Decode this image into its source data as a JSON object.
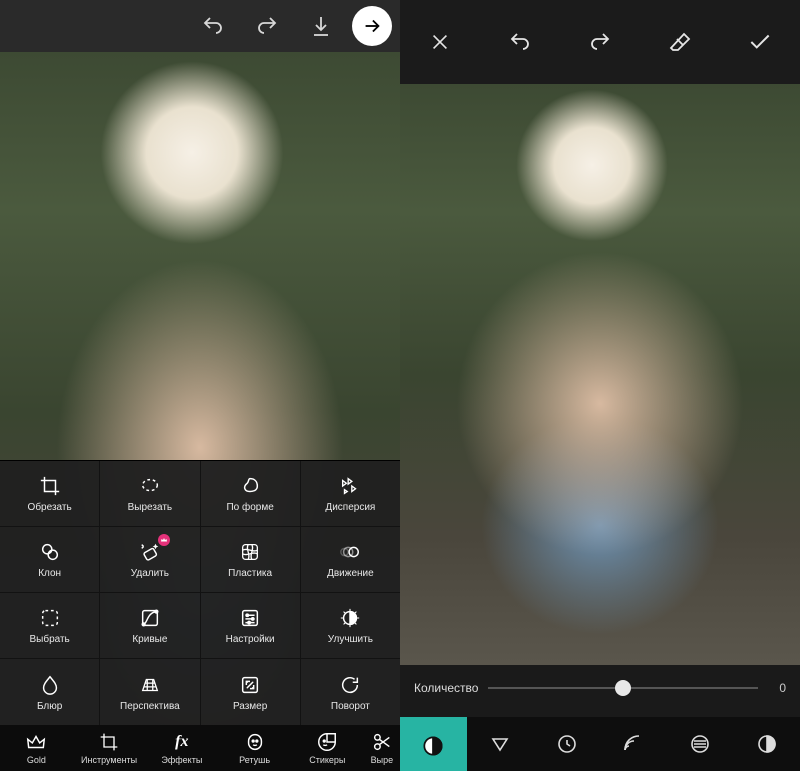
{
  "left": {
    "topbar": {
      "undo": "undo-icon",
      "redo": "redo-icon",
      "download": "download-icon",
      "next": "arrow-right-icon"
    },
    "tools": {
      "rows": [
        [
          {
            "name": "crop-tool",
            "icon": "crop-icon",
            "label": "Обрезать"
          },
          {
            "name": "cut-tool",
            "icon": "lasso-icon",
            "label": "Вырезать"
          },
          {
            "name": "shape-tool",
            "icon": "shape-icon",
            "label": "По форме"
          },
          {
            "name": "dispersion-tool",
            "icon": "dispersion-icon",
            "label": "Дисперсия"
          }
        ],
        [
          {
            "name": "clone-tool",
            "icon": "clone-icon",
            "label": "Клон"
          },
          {
            "name": "remove-tool",
            "icon": "eraser-sparkle-icon",
            "label": "Удалить",
            "badge": true
          },
          {
            "name": "plastic-tool",
            "icon": "warp-grid-icon",
            "label": "Пластика"
          },
          {
            "name": "motion-tool",
            "icon": "motion-icon",
            "label": "Движение"
          }
        ],
        [
          {
            "name": "select-tool",
            "icon": "select-rect-icon",
            "label": "Выбрать"
          },
          {
            "name": "curves-tool",
            "icon": "curves-icon",
            "label": "Кривые"
          },
          {
            "name": "settings-tool",
            "icon": "sliders-icon",
            "label": "Настройки"
          },
          {
            "name": "enhance-tool",
            "icon": "enhance-icon",
            "label": "Улучшить"
          }
        ],
        [
          {
            "name": "blur-tool",
            "icon": "blur-icon",
            "label": "Блюр"
          },
          {
            "name": "perspective-tool",
            "icon": "perspective-icon",
            "label": "Перспектива"
          },
          {
            "name": "size-tool",
            "icon": "resize-icon",
            "label": "Размер"
          },
          {
            "name": "rotate-tool",
            "icon": "rotate-icon",
            "label": "Поворот"
          }
        ]
      ]
    },
    "bottombar": [
      {
        "name": "gold-tab",
        "icon": "crown-icon",
        "label": "Gold"
      },
      {
        "name": "tools-tab",
        "icon": "crop-icon",
        "label": "Инструменты"
      },
      {
        "name": "effects-tab",
        "icon": "fx-icon",
        "label": "Эффекты"
      },
      {
        "name": "retouch-tab",
        "icon": "face-icon",
        "label": "Ретушь"
      },
      {
        "name": "stickers-tab",
        "icon": "sticker-icon",
        "label": "Стикеры"
      },
      {
        "name": "cut-tab",
        "icon": "scissors-icon",
        "label": "Выре"
      }
    ]
  },
  "right": {
    "topbar": {
      "close": "close-icon",
      "undo": "undo-icon",
      "redo": "redo-icon",
      "eraser": "eraser-icon",
      "apply": "check-icon"
    },
    "slider": {
      "label": "Количество",
      "value": "0",
      "percent": 50
    },
    "fxbar": [
      {
        "name": "fx-contrast",
        "icon": "half-circle-icon",
        "active": true
      },
      {
        "name": "fx-triangle",
        "icon": "triangle-down-icon"
      },
      {
        "name": "fx-clock",
        "icon": "clock-icon"
      },
      {
        "name": "fx-arcs",
        "icon": "arcs-icon"
      },
      {
        "name": "fx-stripes",
        "icon": "striped-circle-icon"
      },
      {
        "name": "fx-half",
        "icon": "half-circle2-icon"
      }
    ]
  },
  "colors": {
    "accent": "#27b4a3",
    "badge": "#e5317a"
  }
}
